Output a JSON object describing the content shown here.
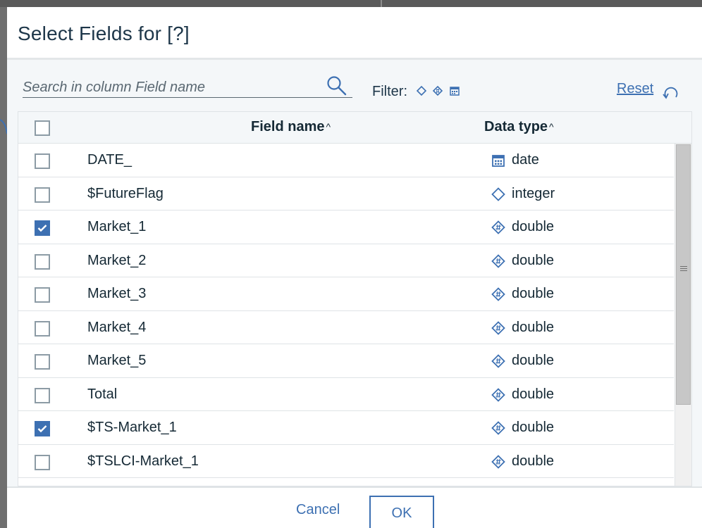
{
  "dialog": {
    "title": "Select Fields for [?]"
  },
  "search": {
    "placeholder": "Search in column Field name",
    "value": ""
  },
  "filter": {
    "label": "Filter:",
    "icons": [
      "integer-type-icon",
      "double-type-icon",
      "date-type-icon"
    ]
  },
  "reset": {
    "label": "Reset"
  },
  "table": {
    "columns": [
      "Field name",
      "Data type"
    ],
    "sort_indicator": "^",
    "rows": [
      {
        "name": "DATE_",
        "type": "date",
        "icon": "date-type-icon",
        "checked": false
      },
      {
        "name": "$FutureFlag",
        "type": "integer",
        "icon": "integer-type-icon",
        "checked": false
      },
      {
        "name": "Market_1",
        "type": "double",
        "icon": "double-type-icon",
        "checked": true
      },
      {
        "name": "Market_2",
        "type": "double",
        "icon": "double-type-icon",
        "checked": false
      },
      {
        "name": "Market_3",
        "type": "double",
        "icon": "double-type-icon",
        "checked": false
      },
      {
        "name": "Market_4",
        "type": "double",
        "icon": "double-type-icon",
        "checked": false
      },
      {
        "name": "Market_5",
        "type": "double",
        "icon": "double-type-icon",
        "checked": false
      },
      {
        "name": "Total",
        "type": "double",
        "icon": "double-type-icon",
        "checked": false
      },
      {
        "name": "$TS-Market_1",
        "type": "double",
        "icon": "double-type-icon",
        "checked": true
      },
      {
        "name": "$TSLCI-Market_1",
        "type": "double",
        "icon": "double-type-icon",
        "checked": false
      }
    ]
  },
  "footer": {
    "cancel_label": "Cancel",
    "ok_label": "OK"
  },
  "colors": {
    "accent": "#3d70b2",
    "title_text": "#1d3649",
    "body_text": "#152935",
    "checkbox_border": "#8c9ba5"
  }
}
